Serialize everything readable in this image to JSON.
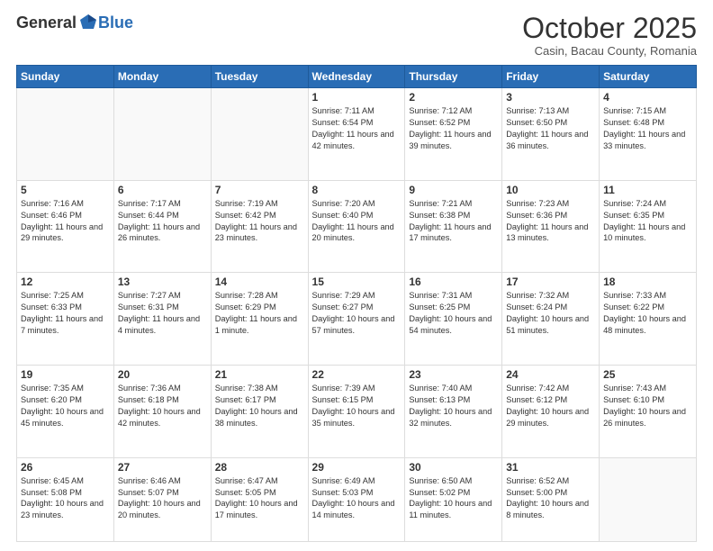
{
  "header": {
    "logo_general": "General",
    "logo_blue": "Blue",
    "month_title": "October 2025",
    "location": "Casin, Bacau County, Romania"
  },
  "days_of_week": [
    "Sunday",
    "Monday",
    "Tuesday",
    "Wednesday",
    "Thursday",
    "Friday",
    "Saturday"
  ],
  "weeks": [
    [
      {
        "day": "",
        "sunrise": "",
        "sunset": "",
        "daylight": ""
      },
      {
        "day": "",
        "sunrise": "",
        "sunset": "",
        "daylight": ""
      },
      {
        "day": "",
        "sunrise": "",
        "sunset": "",
        "daylight": ""
      },
      {
        "day": "1",
        "sunrise": "Sunrise: 7:11 AM",
        "sunset": "Sunset: 6:54 PM",
        "daylight": "Daylight: 11 hours and 42 minutes."
      },
      {
        "day": "2",
        "sunrise": "Sunrise: 7:12 AM",
        "sunset": "Sunset: 6:52 PM",
        "daylight": "Daylight: 11 hours and 39 minutes."
      },
      {
        "day": "3",
        "sunrise": "Sunrise: 7:13 AM",
        "sunset": "Sunset: 6:50 PM",
        "daylight": "Daylight: 11 hours and 36 minutes."
      },
      {
        "day": "4",
        "sunrise": "Sunrise: 7:15 AM",
        "sunset": "Sunset: 6:48 PM",
        "daylight": "Daylight: 11 hours and 33 minutes."
      }
    ],
    [
      {
        "day": "5",
        "sunrise": "Sunrise: 7:16 AM",
        "sunset": "Sunset: 6:46 PM",
        "daylight": "Daylight: 11 hours and 29 minutes."
      },
      {
        "day": "6",
        "sunrise": "Sunrise: 7:17 AM",
        "sunset": "Sunset: 6:44 PM",
        "daylight": "Daylight: 11 hours and 26 minutes."
      },
      {
        "day": "7",
        "sunrise": "Sunrise: 7:19 AM",
        "sunset": "Sunset: 6:42 PM",
        "daylight": "Daylight: 11 hours and 23 minutes."
      },
      {
        "day": "8",
        "sunrise": "Sunrise: 7:20 AM",
        "sunset": "Sunset: 6:40 PM",
        "daylight": "Daylight: 11 hours and 20 minutes."
      },
      {
        "day": "9",
        "sunrise": "Sunrise: 7:21 AM",
        "sunset": "Sunset: 6:38 PM",
        "daylight": "Daylight: 11 hours and 17 minutes."
      },
      {
        "day": "10",
        "sunrise": "Sunrise: 7:23 AM",
        "sunset": "Sunset: 6:36 PM",
        "daylight": "Daylight: 11 hours and 13 minutes."
      },
      {
        "day": "11",
        "sunrise": "Sunrise: 7:24 AM",
        "sunset": "Sunset: 6:35 PM",
        "daylight": "Daylight: 11 hours and 10 minutes."
      }
    ],
    [
      {
        "day": "12",
        "sunrise": "Sunrise: 7:25 AM",
        "sunset": "Sunset: 6:33 PM",
        "daylight": "Daylight: 11 hours and 7 minutes."
      },
      {
        "day": "13",
        "sunrise": "Sunrise: 7:27 AM",
        "sunset": "Sunset: 6:31 PM",
        "daylight": "Daylight: 11 hours and 4 minutes."
      },
      {
        "day": "14",
        "sunrise": "Sunrise: 7:28 AM",
        "sunset": "Sunset: 6:29 PM",
        "daylight": "Daylight: 11 hours and 1 minute."
      },
      {
        "day": "15",
        "sunrise": "Sunrise: 7:29 AM",
        "sunset": "Sunset: 6:27 PM",
        "daylight": "Daylight: 10 hours and 57 minutes."
      },
      {
        "day": "16",
        "sunrise": "Sunrise: 7:31 AM",
        "sunset": "Sunset: 6:25 PM",
        "daylight": "Daylight: 10 hours and 54 minutes."
      },
      {
        "day": "17",
        "sunrise": "Sunrise: 7:32 AM",
        "sunset": "Sunset: 6:24 PM",
        "daylight": "Daylight: 10 hours and 51 minutes."
      },
      {
        "day": "18",
        "sunrise": "Sunrise: 7:33 AM",
        "sunset": "Sunset: 6:22 PM",
        "daylight": "Daylight: 10 hours and 48 minutes."
      }
    ],
    [
      {
        "day": "19",
        "sunrise": "Sunrise: 7:35 AM",
        "sunset": "Sunset: 6:20 PM",
        "daylight": "Daylight: 10 hours and 45 minutes."
      },
      {
        "day": "20",
        "sunrise": "Sunrise: 7:36 AM",
        "sunset": "Sunset: 6:18 PM",
        "daylight": "Daylight: 10 hours and 42 minutes."
      },
      {
        "day": "21",
        "sunrise": "Sunrise: 7:38 AM",
        "sunset": "Sunset: 6:17 PM",
        "daylight": "Daylight: 10 hours and 38 minutes."
      },
      {
        "day": "22",
        "sunrise": "Sunrise: 7:39 AM",
        "sunset": "Sunset: 6:15 PM",
        "daylight": "Daylight: 10 hours and 35 minutes."
      },
      {
        "day": "23",
        "sunrise": "Sunrise: 7:40 AM",
        "sunset": "Sunset: 6:13 PM",
        "daylight": "Daylight: 10 hours and 32 minutes."
      },
      {
        "day": "24",
        "sunrise": "Sunrise: 7:42 AM",
        "sunset": "Sunset: 6:12 PM",
        "daylight": "Daylight: 10 hours and 29 minutes."
      },
      {
        "day": "25",
        "sunrise": "Sunrise: 7:43 AM",
        "sunset": "Sunset: 6:10 PM",
        "daylight": "Daylight: 10 hours and 26 minutes."
      }
    ],
    [
      {
        "day": "26",
        "sunrise": "Sunrise: 6:45 AM",
        "sunset": "Sunset: 5:08 PM",
        "daylight": "Daylight: 10 hours and 23 minutes."
      },
      {
        "day": "27",
        "sunrise": "Sunrise: 6:46 AM",
        "sunset": "Sunset: 5:07 PM",
        "daylight": "Daylight: 10 hours and 20 minutes."
      },
      {
        "day": "28",
        "sunrise": "Sunrise: 6:47 AM",
        "sunset": "Sunset: 5:05 PM",
        "daylight": "Daylight: 10 hours and 17 minutes."
      },
      {
        "day": "29",
        "sunrise": "Sunrise: 6:49 AM",
        "sunset": "Sunset: 5:03 PM",
        "daylight": "Daylight: 10 hours and 14 minutes."
      },
      {
        "day": "30",
        "sunrise": "Sunrise: 6:50 AM",
        "sunset": "Sunset: 5:02 PM",
        "daylight": "Daylight: 10 hours and 11 minutes."
      },
      {
        "day": "31",
        "sunrise": "Sunrise: 6:52 AM",
        "sunset": "Sunset: 5:00 PM",
        "daylight": "Daylight: 10 hours and 8 minutes."
      },
      {
        "day": "",
        "sunrise": "",
        "sunset": "",
        "daylight": ""
      }
    ]
  ]
}
